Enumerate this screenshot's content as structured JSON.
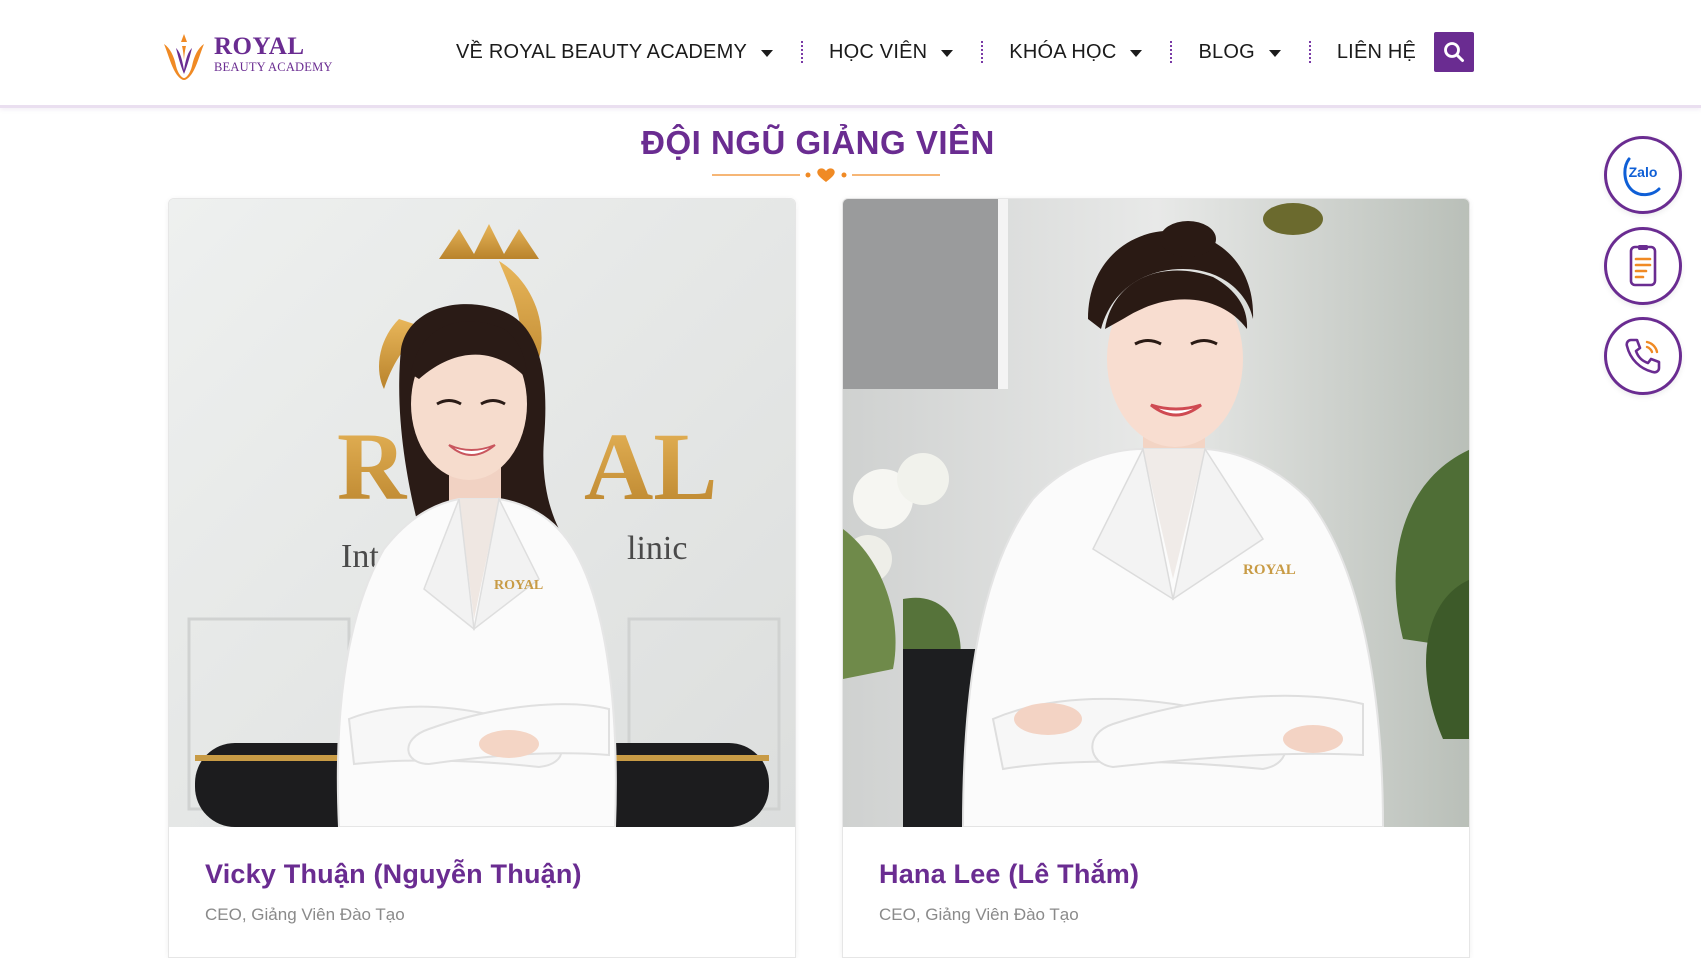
{
  "header": {
    "logo": {
      "title": "ROYAL",
      "subtitle": "BEAUTY ACADEMY"
    },
    "nav": [
      {
        "label": "VỀ ROYAL BEAUTY ACADEMY",
        "has_dropdown": true
      },
      {
        "label": "HỌC VIÊN",
        "has_dropdown": true
      },
      {
        "label": "KHÓA HỌC",
        "has_dropdown": true
      },
      {
        "label": "BLOG",
        "has_dropdown": true
      },
      {
        "label": "LIÊN HỆ",
        "has_dropdown": false
      }
    ],
    "search_icon": "search-icon"
  },
  "section": {
    "title": "ĐỘI NGŨ GIẢNG VIÊN",
    "divider_icon": "heart-icon"
  },
  "instructors": [
    {
      "name": "Vicky Thuận (Nguyễn Thuận)",
      "role": "CEO, Giảng Viên Đào Tạo"
    },
    {
      "name": "Hana Lee (Lê Thắm)",
      "role": "CEO, Giảng Viên Đào Tạo"
    }
  ],
  "floating_contact": {
    "zalo_label": "Zalo",
    "items": [
      "zalo-icon",
      "form-icon",
      "phone-icon"
    ]
  },
  "colors": {
    "brand_purple": "#6a2c91",
    "accent_orange": "#f08a24",
    "zalo_blue": "#0f5fd6"
  }
}
